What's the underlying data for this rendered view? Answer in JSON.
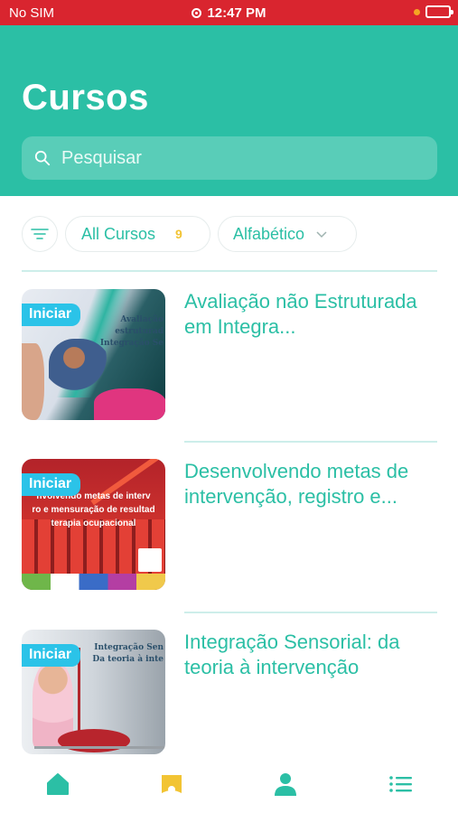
{
  "status_bar": {
    "carrier": "No SIM",
    "time": "12:47 PM"
  },
  "header": {
    "title": "Cursos"
  },
  "search": {
    "placeholder": "Pesquisar"
  },
  "filters": {
    "all_label": "All Cursos",
    "all_count": "9",
    "sort_label": "Alfabético"
  },
  "courses": [
    {
      "badge": "Iniciar",
      "title": "Avaliação não Estruturada em Integra...",
      "thumb_text": [
        "Avaliação",
        "estruturad",
        "Integração Se"
      ]
    },
    {
      "badge": "Iniciar",
      "title": "Desenvolvendo metas de intervenção, registro e...",
      "thumb_text": [
        "nvolvendo metas de interv",
        "ro e mensuração de resultad",
        "terapia ocupacional"
      ]
    },
    {
      "badge": "Iniciar",
      "title": "Integração Sensorial: da teoria à intervenção",
      "thumb_text": [
        "Integração Sen",
        "Da teoria à inte"
      ]
    }
  ],
  "colors": {
    "primary": "#2bbfa5",
    "status_bar": "#d9252f",
    "badge": "#2bc3e8",
    "count": "#f2c434"
  },
  "nav": [
    "home-icon",
    "courses-icon",
    "profile-icon",
    "menu-icon"
  ]
}
